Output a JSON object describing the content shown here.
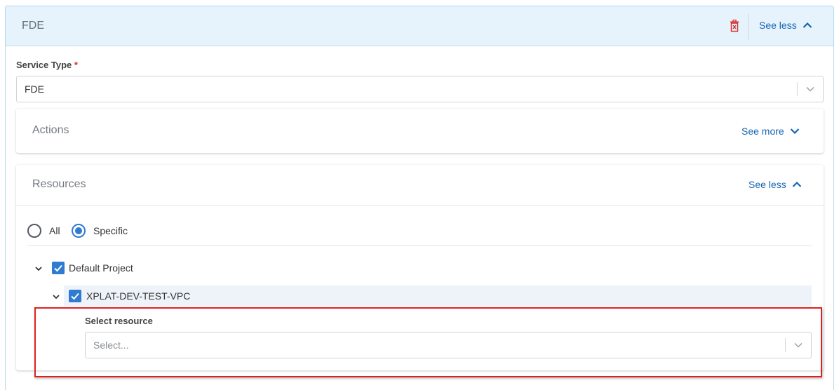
{
  "panel": {
    "title": "FDE",
    "toggle_label": "See less"
  },
  "service_type": {
    "label": "Service Type",
    "required_mark": "*",
    "value": "FDE"
  },
  "actions": {
    "title": "Actions",
    "toggle_label": "See more"
  },
  "resources": {
    "title": "Resources",
    "toggle_label": "See less",
    "scope_options": [
      {
        "label": "All",
        "checked": false
      },
      {
        "label": "Specific",
        "checked": true
      }
    ],
    "tree": {
      "project": {
        "label": "Default Project",
        "checked": true,
        "expanded": true
      },
      "vpc": {
        "label": "XPLAT-DEV-TEST-VPC",
        "checked": true,
        "expanded": true
      }
    },
    "select_resource": {
      "label": "Select resource",
      "placeholder": "Select..."
    }
  },
  "colors": {
    "accent": "#2e7bd1",
    "link": "#1565b3",
    "danger": "#d32f2f",
    "header_bg": "#e6f3fc",
    "highlight_box": "#e02020"
  }
}
